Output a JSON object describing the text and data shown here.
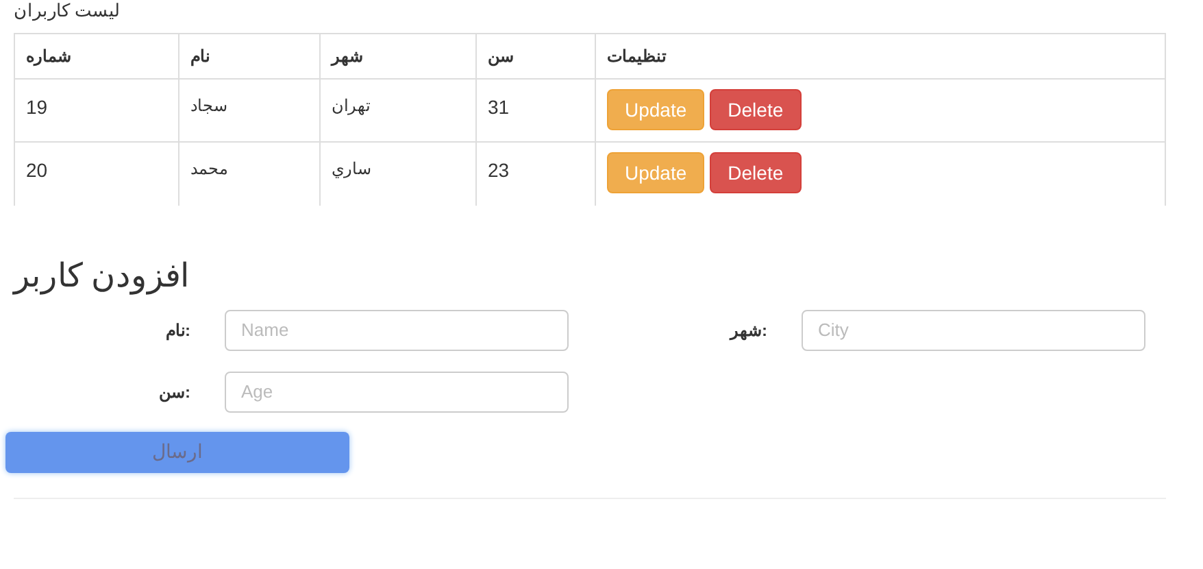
{
  "list_title": "لیست کاربران",
  "table": {
    "columns": [
      "تنظیمات",
      "سن",
      "شهر",
      "نام",
      "شماره"
    ],
    "rows": [
      {
        "cells": [
          {
            "kind": "actions",
            "buttons": [
              {
                "label": "Update",
                "kind": "warning"
              },
              {
                "label": "Delete",
                "kind": "danger"
              }
            ]
          },
          {
            "kind": "text",
            "text": "31"
          },
          {
            "kind": "text",
            "text": "تهران"
          },
          {
            "kind": "text",
            "text": "سجاد"
          },
          {
            "kind": "text",
            "text": "19"
          }
        ]
      },
      {
        "cells": [
          {
            "kind": "actions",
            "buttons": [
              {
                "label": "Update",
                "kind": "warning"
              },
              {
                "label": "Delete",
                "kind": "danger"
              }
            ]
          },
          {
            "kind": "text",
            "text": "23"
          },
          {
            "kind": "text",
            "text": "ساري"
          },
          {
            "kind": "text",
            "text": "محمد"
          },
          {
            "kind": "text",
            "text": "20"
          }
        ]
      }
    ]
  },
  "form": {
    "title": "افزودن کاربر",
    "rows": [
      [
        {
          "label": "شهر:",
          "placeholder": "City"
        },
        {
          "label": "نام:",
          "placeholder": "Name"
        }
      ],
      [
        null,
        {
          "label": "سن:",
          "placeholder": "Age"
        }
      ]
    ],
    "submit": {
      "label": "ارسال",
      "disabled": true
    }
  }
}
